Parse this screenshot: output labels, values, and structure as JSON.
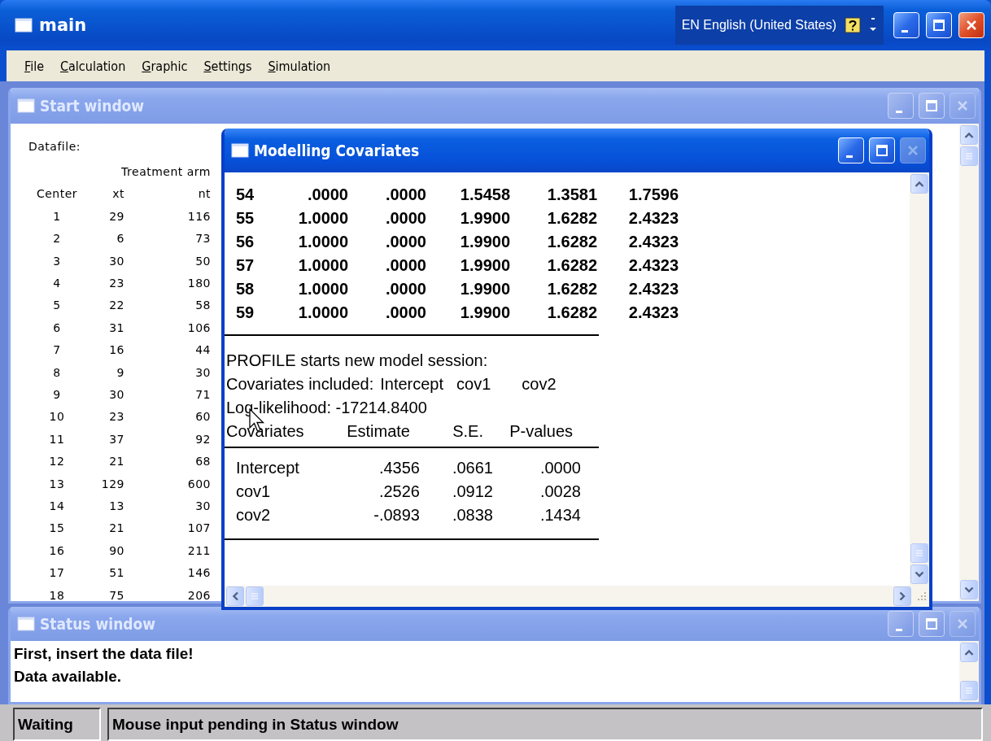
{
  "window": {
    "title": "main",
    "active": true,
    "language": "EN English (United States)"
  },
  "menu": [
    "File",
    "Calculation",
    "Graphic",
    "Settings",
    "Simulation"
  ],
  "start_window": {
    "title": "Start window",
    "active": false,
    "heading": "Datafile:",
    "group_header": "Treatment arm",
    "columns": [
      "Center",
      "xt",
      "nt"
    ],
    "rows": [
      [
        "1",
        "29",
        "116"
      ],
      [
        "2",
        "6",
        "73"
      ],
      [
        "3",
        "30",
        "50"
      ],
      [
        "4",
        "23",
        "180"
      ],
      [
        "5",
        "22",
        "58"
      ],
      [
        "6",
        "31",
        "106"
      ],
      [
        "7",
        "16",
        "44"
      ],
      [
        "8",
        "9",
        "30"
      ],
      [
        "9",
        "30",
        "71"
      ],
      [
        "10",
        "23",
        "60"
      ],
      [
        "11",
        "37",
        "92"
      ],
      [
        "12",
        "21",
        "68"
      ],
      [
        "13",
        "129",
        "600"
      ],
      [
        "14",
        "13",
        "30"
      ],
      [
        "15",
        "21",
        "107"
      ],
      [
        "16",
        "90",
        "211"
      ],
      [
        "17",
        "51",
        "146"
      ],
      [
        "18",
        "75",
        "206"
      ]
    ]
  },
  "modelling_window": {
    "title": "Modelling Covariates",
    "active": true,
    "rows": [
      [
        "54",
        ".0000",
        ".0000",
        "1.5458",
        "1.3581",
        "1.7596"
      ],
      [
        "55",
        "1.0000",
        ".0000",
        "1.9900",
        "1.6282",
        "2.4323"
      ],
      [
        "56",
        "1.0000",
        ".0000",
        "1.9900",
        "1.6282",
        "2.4323"
      ],
      [
        "57",
        "1.0000",
        ".0000",
        "1.9900",
        "1.6282",
        "2.4323"
      ],
      [
        "58",
        "1.0000",
        ".0000",
        "1.9900",
        "1.6282",
        "2.4323"
      ],
      [
        "59",
        "1.0000",
        ".0000",
        "1.9900",
        "1.6282",
        "2.4323"
      ]
    ],
    "session_line": "PROFILE starts new model session:",
    "included_label": "Covariates included:",
    "included": [
      "Intercept",
      "cov1",
      "cov2"
    ],
    "loglik": "Log-likelihood: -17214.8400",
    "coef_columns": [
      "Covariates",
      "Estimate",
      "S.E.",
      "P-values"
    ],
    "coef_rows": [
      [
        "Intercept",
        ".4356",
        ".0661",
        ".0000"
      ],
      [
        "cov1",
        ".2526",
        ".0912",
        ".0028"
      ],
      [
        "cov2",
        "-.0893",
        ".0838",
        ".1434"
      ]
    ]
  },
  "status_window": {
    "title": "Status window",
    "active": false,
    "lines": [
      "First, insert the data file!",
      "Data available."
    ]
  },
  "status_bar": [
    "Waiting",
    "Mouse input pending in Status window"
  ]
}
